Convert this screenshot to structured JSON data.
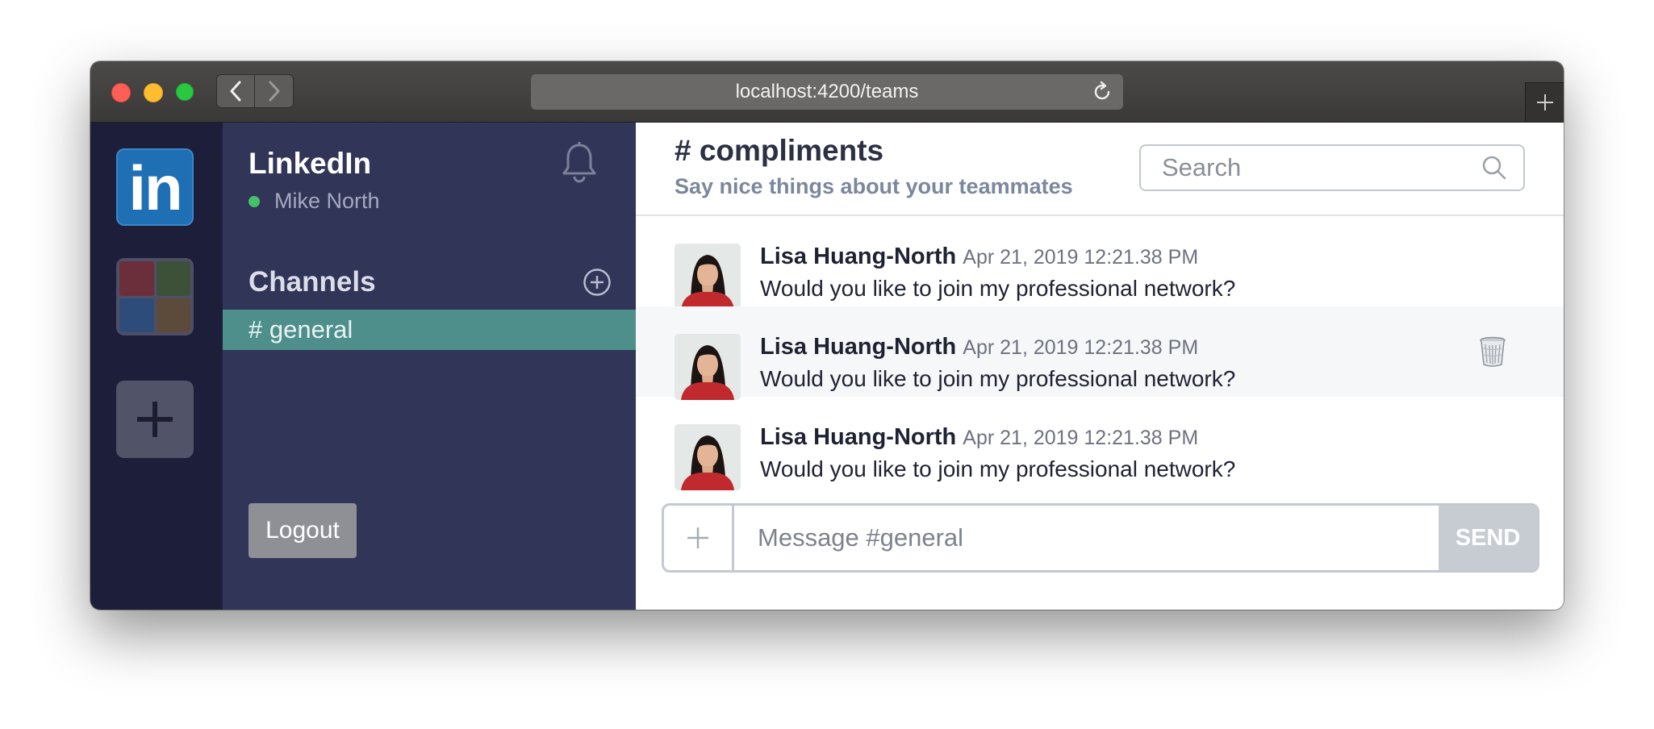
{
  "browser": {
    "url": "localhost:4200/teams"
  },
  "teams": {
    "items": [
      {
        "label": "in",
        "name": "LinkedIn",
        "color": "#1f6fb4"
      },
      {
        "colors": [
          "#6b2f3c",
          "#3d5138",
          "#2e4c7a",
          "#5c4b3a"
        ]
      }
    ]
  },
  "sidebar": {
    "team_name": "LinkedIn",
    "user_name": "Mike North",
    "channels_title": "Channels",
    "channels": [
      {
        "label": "# general",
        "active": true
      }
    ],
    "logout_label": "Logout"
  },
  "channel": {
    "title": "# compliments",
    "description": "Say nice things about your teammates"
  },
  "search": {
    "placeholder": "Search"
  },
  "messages": [
    {
      "author": "Lisa Huang-North",
      "time": "Apr 21, 2019 12:21.38 PM",
      "text": "Would you like to join my professional network?"
    },
    {
      "author": "Lisa Huang-North",
      "time": "Apr 21, 2019 12:21.38 PM",
      "text": "Would you like to join my professional network?"
    },
    {
      "author": "Lisa Huang-North",
      "time": "Apr 21, 2019 12:21.38 PM",
      "text": "Would you like to join my professional network?"
    }
  ],
  "composer": {
    "placeholder": "Message #general",
    "send_label": "SEND"
  },
  "colors": {
    "rail": "#1c1e3a",
    "sidebar": "#313558",
    "active_channel": "#4e8f8c",
    "online": "#44c169"
  }
}
